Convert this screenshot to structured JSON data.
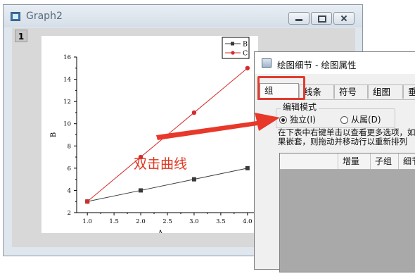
{
  "graph_window": {
    "title": "Graph2",
    "layer_label": "1"
  },
  "chart_data": {
    "type": "line",
    "x": [
      1.0,
      2.0,
      3.0,
      4.0
    ],
    "series": [
      {
        "name": "B",
        "values": [
          3,
          4,
          5,
          6
        ],
        "color": "#3a3a3a",
        "marker": "square"
      },
      {
        "name": "C",
        "values": [
          3,
          7,
          11,
          15
        ],
        "color": "#d62b2b",
        "marker": "circle"
      }
    ],
    "xlabel": "A",
    "ylabel": "B",
    "xlim": [
      0.8,
      4.2
    ],
    "ylim": [
      2,
      16
    ],
    "xticks": [
      "1.0",
      "1.5",
      "2.0",
      "2.5",
      "3.0",
      "3.5",
      "4.0"
    ],
    "yticks": [
      "2",
      "4",
      "6",
      "8",
      "10",
      "12",
      "14",
      "16"
    ],
    "legend_position": "top-right",
    "grid": false
  },
  "annotation": {
    "text": "双击曲线",
    "color": "#e0341f"
  },
  "dialog": {
    "title": "绘图细节 - 绘图属性",
    "tabs": [
      "组",
      "线条",
      "符号",
      "组图",
      "垂"
    ],
    "edit_mode": {
      "legend": "编辑模式",
      "options": [
        "独立(I)",
        "从属(D)"
      ],
      "selected": 0
    },
    "description_lines": [
      "在下表中右键单击以查看更多选项，如",
      "果嵌套，则拖动并移动行以重新排列"
    ],
    "table_headers": [
      "增量",
      "子组",
      "细节"
    ]
  },
  "colors": {
    "highlight": "#e23b2e",
    "arrow": "#e8382a"
  }
}
